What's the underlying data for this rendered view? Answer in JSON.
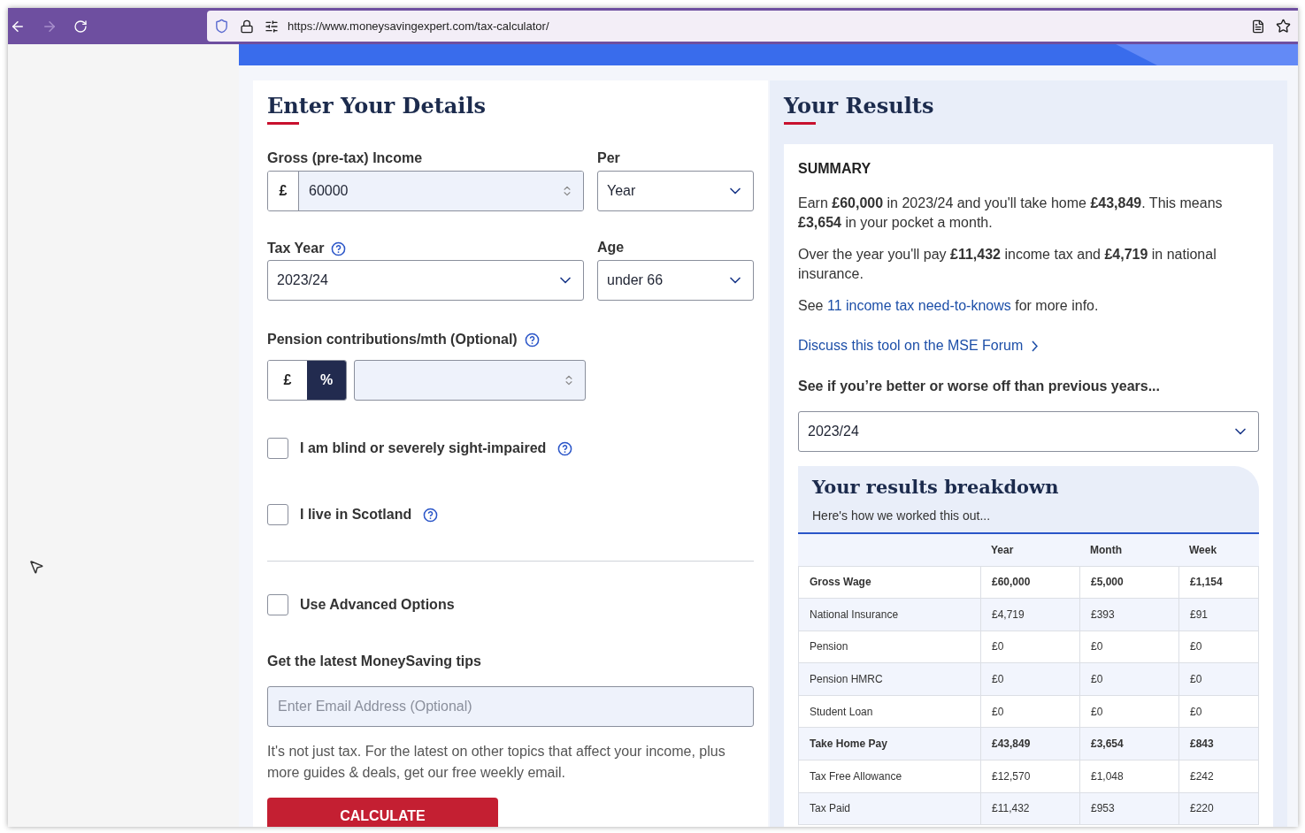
{
  "browser": {
    "url": "https://www.moneysavingexpert.com/tax-calculator/"
  },
  "form": {
    "title": "Enter Your Details",
    "income": {
      "label": "Gross (pre-tax) Income",
      "currency": "£",
      "value": "60000"
    },
    "per": {
      "label": "Per",
      "value": "Year"
    },
    "tax_year": {
      "label": "Tax Year",
      "value": "2023/24"
    },
    "age": {
      "label": "Age",
      "value": "under 66"
    },
    "pension": {
      "label": "Pension contributions/mth (Optional)",
      "units": [
        {
          "label": "£",
          "selected": false
        },
        {
          "label": "%",
          "selected": true
        }
      ]
    },
    "checkboxes": [
      {
        "label": "I am blind or severely sight-impaired",
        "checked": false
      },
      {
        "label": "I live in Scotland",
        "checked": false
      }
    ],
    "advanced": {
      "label": "Use Advanced Options",
      "checked": false
    },
    "newsletter": {
      "heading": "Get the latest MoneySaving tips",
      "placeholder": "Enter Email Address (Optional)",
      "text": "It's not just tax. For the latest on other topics that affect your income, plus more guides & deals, get our free weekly email."
    },
    "calculate": "CALCULATE"
  },
  "results": {
    "title": "Your Results",
    "summary": {
      "heading": "SUMMARY",
      "paragraphs": [
        {
          "before": "Earn **£60,000** in 2023/24 and you'll take home **£43,849**. This means **£3,654** in your pocket a month."
        },
        {
          "before": "Over the year you'll pay **£11,432** income tax and **£4,719** in national insurance."
        },
        {
          "before": "See ",
          "link": "11 income tax need-to-knows",
          "after": " for more info."
        }
      ]
    },
    "forum_link": "Discuss this tool on the MSE Forum",
    "compare": {
      "label": "See if you’re better or worse off than previous years...",
      "value": "2023/24"
    },
    "breakdown": {
      "title": "Your results breakdown",
      "subtitle": "Here's how we worked this out...",
      "columns": [
        "",
        "Year",
        "Month",
        "Week"
      ],
      "rows": [
        {
          "cells": [
            "Gross Wage",
            "£60,000",
            "£5,000",
            "£1,154"
          ],
          "bold": true
        },
        {
          "cells": [
            "National Insurance",
            "£4,719",
            "£393",
            "£91"
          ],
          "bold": false
        },
        {
          "cells": [
            "Pension",
            "£0",
            "£0",
            "£0"
          ],
          "bold": false
        },
        {
          "cells": [
            "Pension HMRC",
            "£0",
            "£0",
            "£0"
          ],
          "bold": false
        },
        {
          "cells": [
            "Student Loan",
            "£0",
            "£0",
            "£0"
          ],
          "bold": false
        },
        {
          "cells": [
            "Take Home Pay",
            "£43,849",
            "£3,654",
            "£843"
          ],
          "bold": true
        },
        {
          "cells": [
            "Tax Free Allowance",
            "£12,570",
            "£1,048",
            "£242"
          ],
          "bold": false
        },
        {
          "cells": [
            "Tax Paid",
            "£11,432",
            "£953",
            "£220"
          ],
          "bold": false
        }
      ]
    }
  }
}
